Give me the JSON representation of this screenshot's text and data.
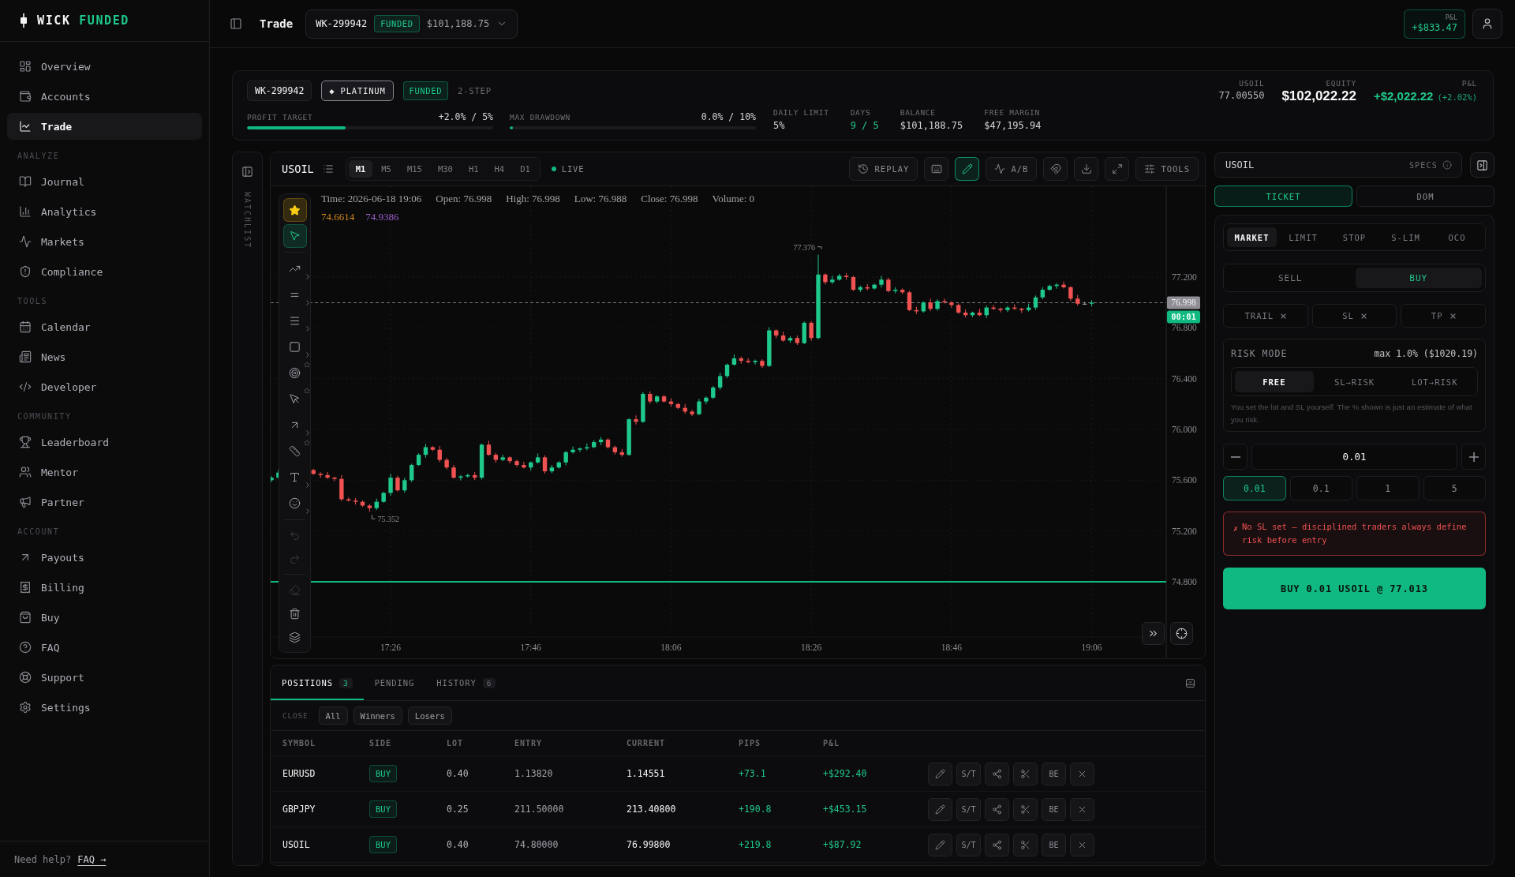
{
  "sidebar": {
    "brand": {
      "name": "WICK",
      "accent": "FUNDED"
    },
    "sections": [
      {
        "items": [
          {
            "label": "Overview",
            "selected": false
          },
          {
            "label": "Accounts",
            "selected": false
          },
          {
            "label": "Trade",
            "selected": true
          }
        ]
      },
      {
        "title": "ANALYZE",
        "items": [
          {
            "label": "Journal",
            "selected": false
          },
          {
            "label": "Analytics",
            "selected": false
          },
          {
            "label": "Markets",
            "selected": false
          },
          {
            "label": "Compliance",
            "selected": false
          }
        ]
      },
      {
        "title": "TOOLS",
        "items": [
          {
            "label": "Calendar",
            "selected": false
          },
          {
            "label": "News",
            "selected": false
          },
          {
            "label": "Developer",
            "selected": false
          }
        ]
      },
      {
        "title": "COMMUNITY",
        "items": [
          {
            "label": "Leaderboard",
            "selected": false
          },
          {
            "label": "Mentor",
            "selected": false
          },
          {
            "label": "Partner",
            "selected": false
          }
        ]
      },
      {
        "title": "ACCOUNT",
        "items": [
          {
            "label": "Payouts",
            "selected": false
          },
          {
            "label": "Billing",
            "selected": false
          },
          {
            "label": "Buy",
            "selected": false
          },
          {
            "label": "FAQ",
            "selected": false
          },
          {
            "label": "Support",
            "selected": false
          },
          {
            "label": "Settings",
            "selected": false
          }
        ]
      }
    ],
    "help": {
      "text": "Need help?",
      "link": "FAQ →"
    }
  },
  "topbar": {
    "title": "Trade",
    "account": {
      "id": "WK-299942",
      "status": "FUNDED",
      "balance": "$101,188.75"
    },
    "pnl": {
      "label": "P&L",
      "value": "+$833.47"
    }
  },
  "account_summary": {
    "id": "WK-299942",
    "tier": "◆ PLATINUM",
    "status": "FUNDED",
    "program": "2-STEP",
    "progress": [
      {
        "label": "PROFIT TARGET",
        "reading": "+2.0% / 5%",
        "level": 0.4
      },
      {
        "label": "MAX DRAWDOWN",
        "reading": "0.0% / 10%",
        "level": 0.012
      }
    ],
    "stats": [
      {
        "label": "DAILY LIMIT",
        "value": "5%",
        "kind": "plain"
      },
      {
        "label": "DAYS",
        "value": "9 / 5",
        "kind": "positive"
      },
      {
        "label": "BALANCE",
        "value": "$101,188.75",
        "kind": "plain"
      },
      {
        "label": "FREE MARGIN",
        "value": "$47,195.94",
        "kind": "plain"
      }
    ],
    "quote": {
      "symbol": "USOIL",
      "price": "77.00550"
    },
    "equity": {
      "label": "EQUITY",
      "value": "$102,022.22"
    },
    "pnl": {
      "label": "P&L",
      "value": "+$2,022.22",
      "change": "(+2.02%)"
    }
  },
  "watchlist": {
    "label": "WATCHLIST"
  },
  "chart": {
    "symbol": "USOIL",
    "timeframes": [
      {
        "label": "M1",
        "selected": true
      },
      {
        "label": "M5",
        "selected": false
      },
      {
        "label": "M15",
        "selected": false
      },
      {
        "label": "M30",
        "selected": false
      },
      {
        "label": "H1",
        "selected": false
      },
      {
        "label": "H4",
        "selected": false
      },
      {
        "label": "D1",
        "selected": false
      }
    ],
    "status": "LIVE",
    "actions": [
      {
        "kind": "replay",
        "label": "REPLAY",
        "active": false
      },
      {
        "kind": "keyboard",
        "active": false
      },
      {
        "kind": "draw",
        "active": true
      },
      {
        "kind": "compare",
        "label": "A/B",
        "active": false
      },
      {
        "kind": "magnet",
        "active": false
      },
      {
        "kind": "download",
        "active": false
      },
      {
        "kind": "fullscreen",
        "active": false
      },
      {
        "kind": "tools",
        "label": "TOOLS",
        "active": false
      }
    ],
    "legend": [
      "Time: 2026-06-18 19:06",
      "Open: 76.998",
      "High: 76.998",
      "Low: 76.988",
      "Close: 76.998",
      "Volume: 0"
    ],
    "indicators": [
      {
        "value": "74.6614",
        "color": "#d4881e"
      },
      {
        "value": "74.9386",
        "color": "#9a5fc9"
      }
    ],
    "price_ticks": [
      "77.200",
      "76.800",
      "76.400",
      "76.000",
      "75.600",
      "75.200",
      "74.800"
    ],
    "time_ticks": [
      "17:26",
      "17:46",
      "18:06",
      "18:26",
      "18:46",
      "19:06"
    ],
    "last_price": "76.998",
    "countdown": "00:01",
    "session_high": "77.376",
    "session_low": "75.352",
    "favorites": {
      "on": true
    },
    "tool_groups": [
      {
        "tools": [
          {
            "kind": "cursor",
            "selected": true,
            "starred": false,
            "submenu": false,
            "disabled": false
          }
        ]
      },
      {
        "tools": [
          {
            "kind": "trend",
            "selected": false,
            "starred": false,
            "submenu": true,
            "disabled": false
          },
          {
            "kind": "parallel",
            "selected": false,
            "starred": false,
            "submenu": true,
            "disabled": false
          },
          {
            "kind": "lines",
            "selected": false,
            "starred": false,
            "submenu": true,
            "disabled": false
          },
          {
            "kind": "rectangle",
            "selected": false,
            "starred": false,
            "submenu": true,
            "disabled": false
          },
          {
            "kind": "target",
            "selected": false,
            "starred": true,
            "submenu": false,
            "disabled": false
          },
          {
            "kind": "pointer",
            "selected": false,
            "starred": true,
            "submenu": false,
            "disabled": false
          },
          {
            "kind": "arrow",
            "selected": false,
            "starred": false,
            "submenu": true,
            "disabled": false
          },
          {
            "kind": "ruler",
            "selected": false,
            "starred": true,
            "submenu": false,
            "disabled": false
          },
          {
            "kind": "text",
            "selected": false,
            "starred": false,
            "submenu": true,
            "disabled": false
          },
          {
            "kind": "emoji",
            "selected": false,
            "starred": false,
            "submenu": true,
            "disabled": false
          }
        ]
      },
      {
        "tools": [
          {
            "kind": "undo",
            "selected": false,
            "starred": false,
            "submenu": false,
            "disabled": true
          },
          {
            "kind": "redo",
            "selected": false,
            "starred": false,
            "submenu": false,
            "disabled": true
          }
        ]
      },
      {
        "tools": [
          {
            "kind": "eraser",
            "selected": false,
            "starred": false,
            "submenu": false,
            "disabled": true
          },
          {
            "kind": "trash",
            "selected": false,
            "starred": false,
            "submenu": false,
            "disabled": false
          },
          {
            "kind": "layers",
            "selected": false,
            "starred": false,
            "submenu": false,
            "disabled": false
          }
        ]
      }
    ]
  },
  "positions": {
    "tabs": [
      {
        "label": "POSITIONS",
        "count": "3",
        "selected": true
      },
      {
        "label": "PENDING",
        "selected": false
      },
      {
        "label": "HISTORY",
        "count": "6",
        "selected": false
      }
    ],
    "close_label": "CLOSE",
    "close_filters": [
      "All",
      "Winners",
      "Losers"
    ],
    "columns": [
      "SYMBOL",
      "SIDE",
      "LOT",
      "ENTRY",
      "CURRENT",
      "PIPS",
      "P&L"
    ],
    "rows": [
      {
        "symbol": "EURUSD",
        "side": "BUY",
        "lot": "0.40",
        "entry": "1.13820",
        "current": "1.14551",
        "pips": "+73.1",
        "pnl": "+$292.40",
        "actions": {
          "stop_target": "S/T",
          "breakeven": "BE"
        }
      },
      {
        "symbol": "GBPJPY",
        "side": "BUY",
        "lot": "0.25",
        "entry": "211.50000",
        "current": "213.40800",
        "pips": "+190.8",
        "pnl": "+$453.15",
        "actions": {
          "stop_target": "S/T",
          "breakeven": "BE"
        }
      },
      {
        "symbol": "USOIL",
        "side": "BUY",
        "lot": "0.40",
        "entry": "74.80000",
        "current": "76.99800",
        "pips": "+219.8",
        "pnl": "+$87.92",
        "actions": {
          "stop_target": "S/T",
          "breakeven": "BE"
        }
      }
    ]
  },
  "order_ticket": {
    "symbol": "USOIL",
    "specs": "SPECS",
    "views": [
      {
        "label": "TICKET",
        "selected": true
      },
      {
        "label": "DOM",
        "selected": false
      }
    ],
    "order_types": [
      {
        "label": "MARKET",
        "selected": true
      },
      {
        "label": "LIMIT",
        "selected": false
      },
      {
        "label": "STOP",
        "selected": false
      },
      {
        "label": "S-LIM",
        "selected": false
      },
      {
        "label": "OCO",
        "selected": false
      }
    ],
    "sides": [
      {
        "label": "SELL",
        "kind": "sell",
        "selected": false
      },
      {
        "label": "BUY",
        "kind": "buy",
        "selected": true
      }
    ],
    "attachments": [
      {
        "label": "TRAIL"
      },
      {
        "label": "SL"
      },
      {
        "label": "TP"
      }
    ],
    "risk": {
      "title": "RISK MODE",
      "limit": "max 1.0% ($1020.19)",
      "modes": [
        {
          "label": "FREE",
          "selected": true
        },
        {
          "label": "SL→RISK",
          "selected": false
        },
        {
          "label": "LOT→RISK",
          "selected": false
        }
      ],
      "hint": "You set the lot and SL yourself. The % shown is just an estimate of what you risk."
    },
    "lot": "0.01",
    "lot_presets": [
      {
        "label": "0.01",
        "selected": true
      },
      {
        "label": "0.1",
        "selected": false
      },
      {
        "label": "1",
        "selected": false
      },
      {
        "label": "5",
        "selected": false
      }
    ],
    "warning": {
      "mark": "✗",
      "text": "No SL set — disciplined traders always define risk before entry"
    },
    "submit": "BUY 0.01 USOIL @ 77.013"
  }
}
